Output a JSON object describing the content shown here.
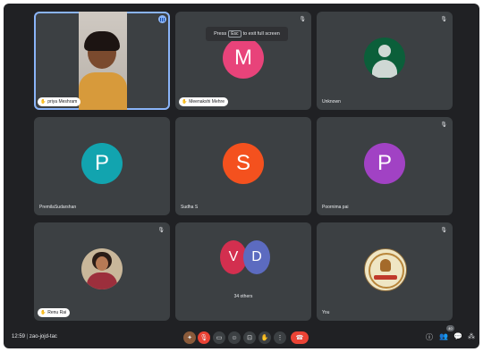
{
  "toast": {
    "prefix": "Press",
    "key": "Esc",
    "suffix": "to exit full screen"
  },
  "tiles": [
    {
      "name": "priya Meshram"
    },
    {
      "name": "Meenakshi Mehre",
      "initial": "M",
      "color": "#e8437a"
    },
    {
      "name": "Unknown"
    },
    {
      "name": "PremilaSudarshan",
      "initial": "P",
      "color": "#12a4af"
    },
    {
      "name": "Sudha S",
      "initial": "S",
      "color": "#f4511e"
    },
    {
      "name": "Poornima pai",
      "initial": "P",
      "color": "#a142c4"
    },
    {
      "name": "Renu Rai"
    },
    {
      "initials": [
        "V",
        "D"
      ],
      "colors": [
        "#d32f4f",
        "#5c6bc0"
      ],
      "caption": "34 others"
    },
    {
      "name": "You"
    }
  ],
  "bottom_bar": {
    "time": "12:59",
    "meeting_code": "zao-jojd-tac",
    "participants_badge": "40"
  }
}
